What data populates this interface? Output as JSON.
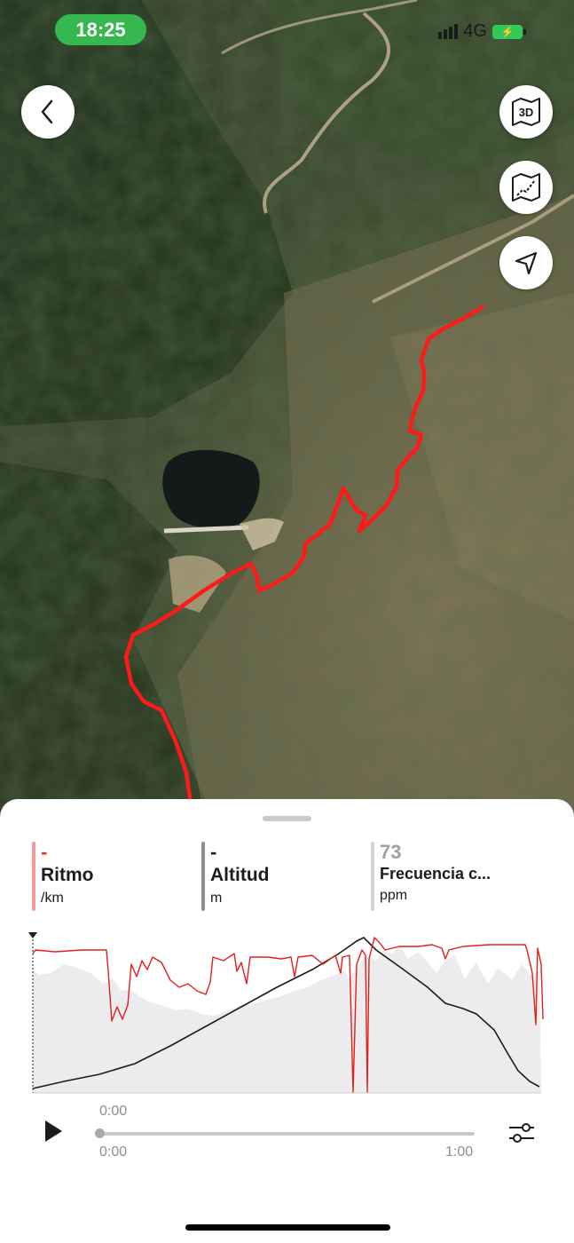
{
  "status_bar": {
    "time": "18:25",
    "network": "4G"
  },
  "map": {
    "back_icon": "chevron-left-icon",
    "buttons": [
      {
        "icon": "map-3d-icon",
        "label": "3D"
      },
      {
        "icon": "map-layers-icon"
      },
      {
        "icon": "navigation-arrow-icon"
      }
    ],
    "route_color": "#ff1a1a"
  },
  "metrics": [
    {
      "value": "-",
      "name": "Ritmo",
      "unit": "/km",
      "color": "#f29a9a",
      "value_color": "#e6312c"
    },
    {
      "value": "-",
      "name": "Altitud",
      "unit": "m",
      "color": "#8e8e93",
      "value_color": "#1c1c1e"
    },
    {
      "value": "73",
      "name": "Frecuencia c...",
      "unit": "ppm",
      "color": "#d1d1d6",
      "value_color": "#a0a0a6"
    }
  ],
  "playback": {
    "current_time": "0:00",
    "start_time": "0:00",
    "end_time": "1:00",
    "progress": 0
  },
  "colors": {
    "pace_line": "#e0201c",
    "altitude_line": "#1c1c1e",
    "heart_rate_fill": "#ececee",
    "status_green": "#34b84f"
  }
}
